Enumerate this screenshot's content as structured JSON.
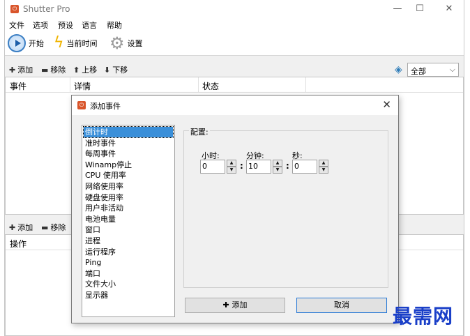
{
  "app": {
    "title": "Shutter Pro",
    "icon": "shutter-app-icon"
  },
  "window_controls": {
    "minimize": "—",
    "maximize": "☐",
    "close": "✕"
  },
  "menu": [
    "文件",
    "选项",
    "预设",
    "语言",
    "帮助"
  ],
  "toolbar": {
    "start": "开始",
    "current_time": "当前时间",
    "settings": "设置"
  },
  "events_bar": {
    "add": "添加",
    "remove": "移除",
    "up": "上移",
    "down": "下移"
  },
  "filter": {
    "value": "全部"
  },
  "events_grid": {
    "columns": [
      "事件",
      "详情",
      "状态"
    ]
  },
  "actions_bar": {
    "add": "添加",
    "remove": "移除"
  },
  "actions_grid": {
    "columns": [
      "操作"
    ]
  },
  "dialog": {
    "title": "添加事件",
    "event_types": [
      "倒计时",
      "准时事件",
      "每周事件",
      "Winamp停止",
      "CPU 使用率",
      "网络使用率",
      "硬盘使用率",
      "用户非活动",
      "电池电量",
      "窗口",
      "进程",
      "运行程序",
      "Ping",
      "端口",
      "文件大小",
      "显示器"
    ],
    "selected_index": 0,
    "config_label": "配置:",
    "hours_label": "小时:",
    "minutes_label": "分钟:",
    "seconds_label": "秒:",
    "hours_value": "0",
    "minutes_value": "10",
    "seconds_value": "0",
    "add_button": "添加",
    "cancel_button": "取消"
  },
  "watermark": "最需网",
  "colors": {
    "accent": "#3a8fd9",
    "app_icon": "#d9552b",
    "watermark": "#1a3fc8"
  }
}
